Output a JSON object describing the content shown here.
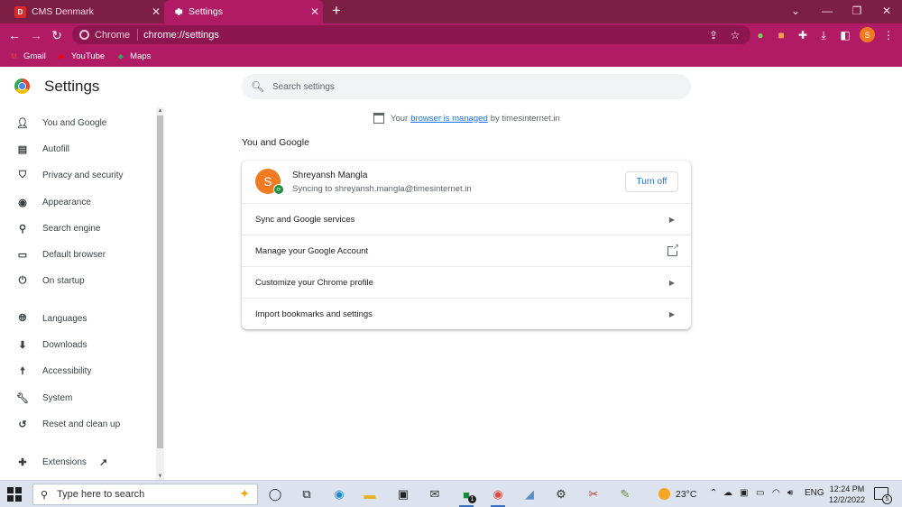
{
  "browser": {
    "tabs": [
      {
        "title": "CMS Denmark",
        "favicon": "cms-denmark-icon"
      },
      {
        "title": "Settings",
        "favicon": "gear-icon"
      }
    ],
    "new_tab": "+",
    "omnibox": {
      "chip": "Chrome",
      "url": "chrome://settings"
    },
    "profile_initial": "S",
    "bookmarks": [
      {
        "label": "Gmail",
        "icon": "gmail-icon"
      },
      {
        "label": "YouTube",
        "icon": "youtube-icon"
      },
      {
        "label": "Maps",
        "icon": "maps-icon"
      }
    ],
    "theme_color": "#b11a65",
    "tabstrip_color": "#7d1e45"
  },
  "settings": {
    "title": "Settings",
    "search_placeholder": "Search settings",
    "sidebar": [
      {
        "label": "You and Google",
        "icon": "person-icon"
      },
      {
        "label": "Autofill",
        "icon": "clipboard-icon"
      },
      {
        "label": "Privacy and security",
        "icon": "shield-icon"
      },
      {
        "label": "Appearance",
        "icon": "palette-icon"
      },
      {
        "label": "Search engine",
        "icon": "search-icon"
      },
      {
        "label": "Default browser",
        "icon": "browser-icon"
      },
      {
        "label": "On startup",
        "icon": "power-icon"
      },
      {
        "label": "Languages",
        "icon": "globe-icon"
      },
      {
        "label": "Downloads",
        "icon": "download-icon"
      },
      {
        "label": "Accessibility",
        "icon": "accessibility-icon"
      },
      {
        "label": "System",
        "icon": "wrench-icon"
      },
      {
        "label": "Reset and clean up",
        "icon": "reset-icon"
      },
      {
        "label": "Extensions",
        "icon": "puzzle-icon"
      }
    ],
    "managed_notice": {
      "prefix": "Your",
      "link": "browser is managed",
      "suffix": "by timesinternet.in"
    },
    "section_title": "You and Google",
    "profile": {
      "initial": "S",
      "name": "Shreyansh Mangla",
      "sync_status": "Syncing to shreyansh.mangla@timesinternet.in",
      "turn_off_label": "Turn off"
    },
    "rows": [
      {
        "label": "Sync and Google services",
        "action": "chevron-right-icon"
      },
      {
        "label": "Manage your Google Account",
        "action": "external-link-icon"
      },
      {
        "label": "Customize your Chrome profile",
        "action": "chevron-right-icon"
      },
      {
        "label": "Import bookmarks and settings",
        "action": "chevron-right-icon"
      }
    ]
  },
  "taskbar": {
    "search_placeholder": "Type here to search",
    "weather": "23°C",
    "language": "ENG",
    "time": "12:24 PM",
    "date": "12/2/2022",
    "notification_count": "5",
    "badge_count": "1"
  }
}
